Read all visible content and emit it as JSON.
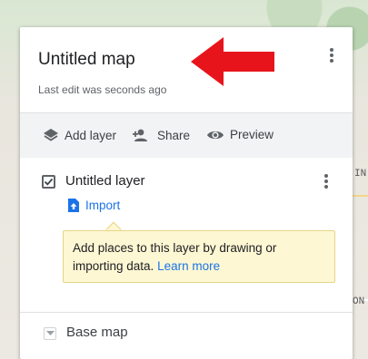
{
  "map": {
    "labels": [
      "IN",
      "ON"
    ]
  },
  "panel": {
    "title": "Untitled map",
    "subtitle": "Last edit was seconds ago"
  },
  "toolbar": {
    "add_layer": "Add layer",
    "share": "Share",
    "preview": "Preview"
  },
  "layer": {
    "name": "Untitled layer",
    "checked": true,
    "import_label": "Import"
  },
  "tooltip": {
    "text": "Add places to this layer by drawing or importing data.",
    "link": "Learn more"
  },
  "base_map": {
    "label": "Base map"
  },
  "colors": {
    "arrow": "#e8141b",
    "link": "#1a73e8",
    "tooltip_bg": "#fef7d3"
  },
  "icons": [
    "more-vert-icon",
    "layers-icon",
    "person-add-icon",
    "eye-icon",
    "checkbox-icon",
    "import-file-icon",
    "chevron-down-icon"
  ]
}
